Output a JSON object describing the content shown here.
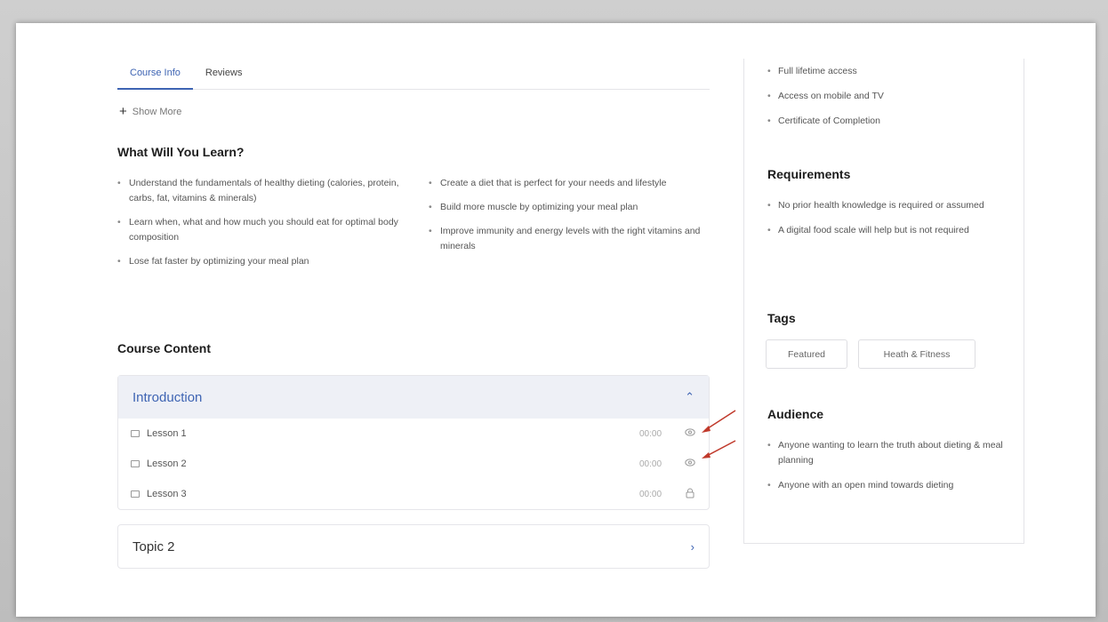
{
  "tabs": [
    {
      "label": "Course Info",
      "active": true
    },
    {
      "label": "Reviews",
      "active": false
    }
  ],
  "show_more": "Show More",
  "learn": {
    "title": "What Will You Learn?",
    "left": [
      "Understand the fundamentals of healthy dieting (calories, protein, carbs, fat, vitamins & minerals)",
      "Learn when, what and how much you should eat for optimal body composition",
      "Lose fat faster by optimizing your meal plan"
    ],
    "right": [
      "Create a diet that is perfect for your needs and lifestyle",
      "Build more muscle by optimizing your meal plan",
      "Improve immunity and energy levels with the right vitamins and minerals"
    ]
  },
  "course_content": {
    "title": "Course Content",
    "topics": [
      {
        "title": "Introduction",
        "lessons": [
          {
            "name": "Lesson 1",
            "time": "00:00",
            "icon": "eye-icon"
          },
          {
            "name": "Lesson 2",
            "time": "00:00",
            "icon": "eye-icon"
          },
          {
            "name": "Lesson 3",
            "time": "00:00",
            "icon": "lock-icon"
          }
        ]
      },
      {
        "title": "Topic 2",
        "lessons": []
      }
    ]
  },
  "sidebar": {
    "includes": [
      "Full lifetime access",
      "Access on mobile and TV",
      "Certificate of Completion"
    ],
    "requirements_title": "Requirements",
    "requirements": [
      "No prior health knowledge is required or assumed",
      "A digital food scale will help but is not required"
    ],
    "tags_title": "Tags",
    "tags": [
      "Featured",
      "Heath & Fitness"
    ],
    "audience_title": "Audience",
    "audience": [
      "Anyone wanting to learn the truth about dieting & meal planning",
      "Anyone with an open mind towards dieting"
    ]
  },
  "colors": {
    "accent": "#3e64b3",
    "annotation_arrow": "#c0392b"
  }
}
